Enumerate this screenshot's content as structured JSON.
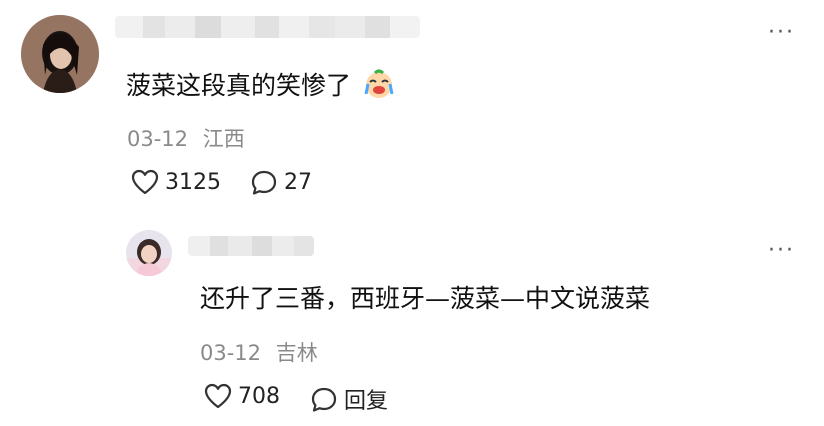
{
  "comments": [
    {
      "text": "菠菜这段真的笑惨了",
      "emoji_icon": "laughing-crying-face-icon",
      "date": "03-12",
      "location": "江西",
      "likes": "3125",
      "reply_count": "27"
    }
  ],
  "replies": [
    {
      "text": "还升了三番，西班牙—菠菜—中文说菠菜",
      "date": "03-12",
      "location": "吉林",
      "likes": "708",
      "reply_label": "回复"
    }
  ],
  "more_label": "···",
  "colors": {
    "text": "#111111",
    "meta": "#8a8a8a",
    "icon": "#333333"
  }
}
